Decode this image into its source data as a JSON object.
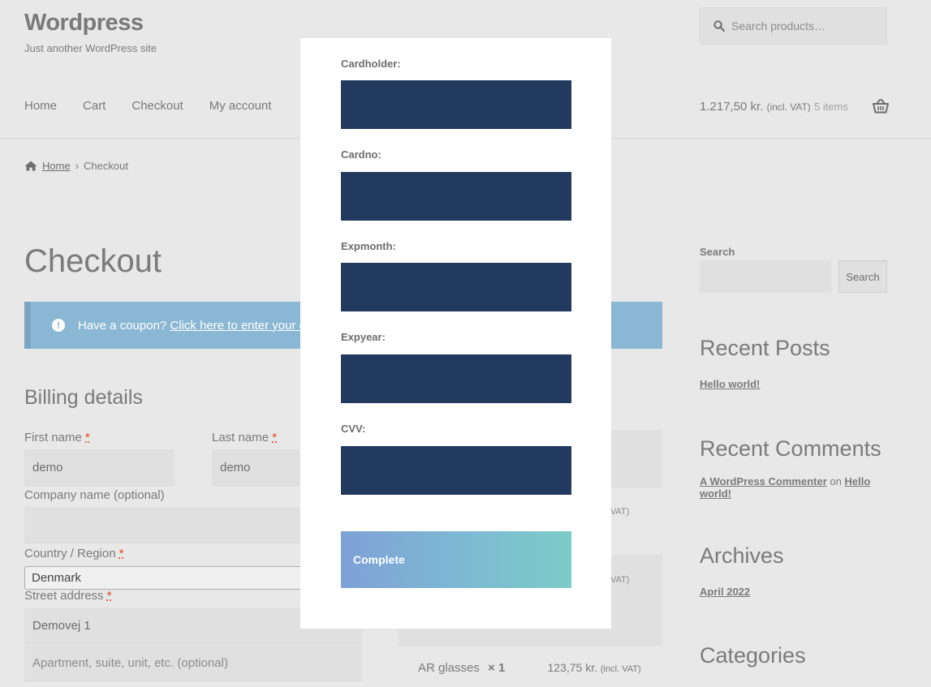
{
  "site": {
    "title": "Wordpress",
    "tagline": "Just another WordPress site"
  },
  "search": {
    "placeholder": "Search products…"
  },
  "nav": {
    "items": [
      "Home",
      "Cart",
      "Checkout",
      "My account"
    ]
  },
  "cart": {
    "total": "1.217,50 kr.",
    "vat_note": "(incl. VAT)",
    "items": "5 items"
  },
  "breadcrumb": {
    "home": "Home",
    "current": "Checkout"
  },
  "checkout": {
    "title": "Checkout",
    "coupon_text": "Have a coupon?",
    "coupon_link": "Click here to enter your code",
    "billing_title": "Billing details",
    "first_name_label": "First name",
    "first_name_value": "demo",
    "last_name_label": "Last name",
    "last_name_value": "demo",
    "required_mark": "*",
    "company_label": "Company name (optional)",
    "country_label": "Country / Region",
    "country_value": "Denmark",
    "street_label": "Street address",
    "street_value": "Demovej 1",
    "apartment_placeholder": "Apartment, suite, unit, etc. (optional)"
  },
  "order": {
    "vat_fragment": "VAT)",
    "line": {
      "name": "AR glasses",
      "qty": "× 1",
      "price": "123,75 kr.",
      "vat": "(incl. VAT)"
    }
  },
  "sidebar": {
    "search_label": "Search",
    "search_button": "Search",
    "recent_posts_title": "Recent Posts",
    "recent_post": "Hello world!",
    "recent_comments_title": "Recent Comments",
    "comment_author": "A WordPress Commenter",
    "comment_on": "on",
    "comment_post": "Hello world!",
    "archives_title": "Archives",
    "archive_item": "April 2022",
    "categories_title": "Categories"
  },
  "modal": {
    "fields": [
      {
        "label": "Cardholder:"
      },
      {
        "label": "Cardno:"
      },
      {
        "label": "Expmonth:"
      },
      {
        "label": "Expyear:"
      },
      {
        "label": "CVV:"
      }
    ],
    "button_label": "Complete"
  },
  "colors": {
    "input_bg": "#223a5e",
    "coupon_bg": "#8ab7d3",
    "button_gradient_start": "#7ea1d6",
    "button_gradient_end": "#7ccbc8"
  }
}
